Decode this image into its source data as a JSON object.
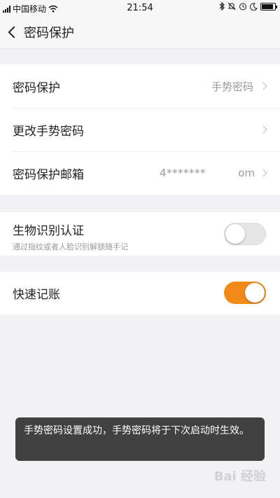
{
  "status_bar": {
    "carrier": "中国移动",
    "time": "21:54",
    "battery_level": 0.9
  },
  "nav": {
    "title": "密码保护"
  },
  "rows": {
    "password_protect": {
      "label": "密码保护",
      "value": "手势密码"
    },
    "change_gesture": {
      "label": "更改手势密码"
    },
    "email": {
      "label": "密码保护邮箱",
      "value_start": "4*******",
      "value_end": "om"
    }
  },
  "biometric": {
    "label": "生物识别认证",
    "description": "通过指纹或者人脸识别解锁随手记",
    "enabled": false
  },
  "quick_bookkeeping": {
    "label": "快速记账",
    "enabled": true
  },
  "toast": {
    "message": "手势密码设置成功，手势密码将于下次启动时生效。"
  },
  "colors": {
    "accent": "#f28a17",
    "background": "#f2f2f4"
  },
  "icons": [
    "signal-icon",
    "wifi-icon",
    "bluetooth-icon",
    "alarm-icon",
    "moon-icon",
    "battery-icon",
    "back-chevron-icon",
    "chevron-right-icon"
  ]
}
